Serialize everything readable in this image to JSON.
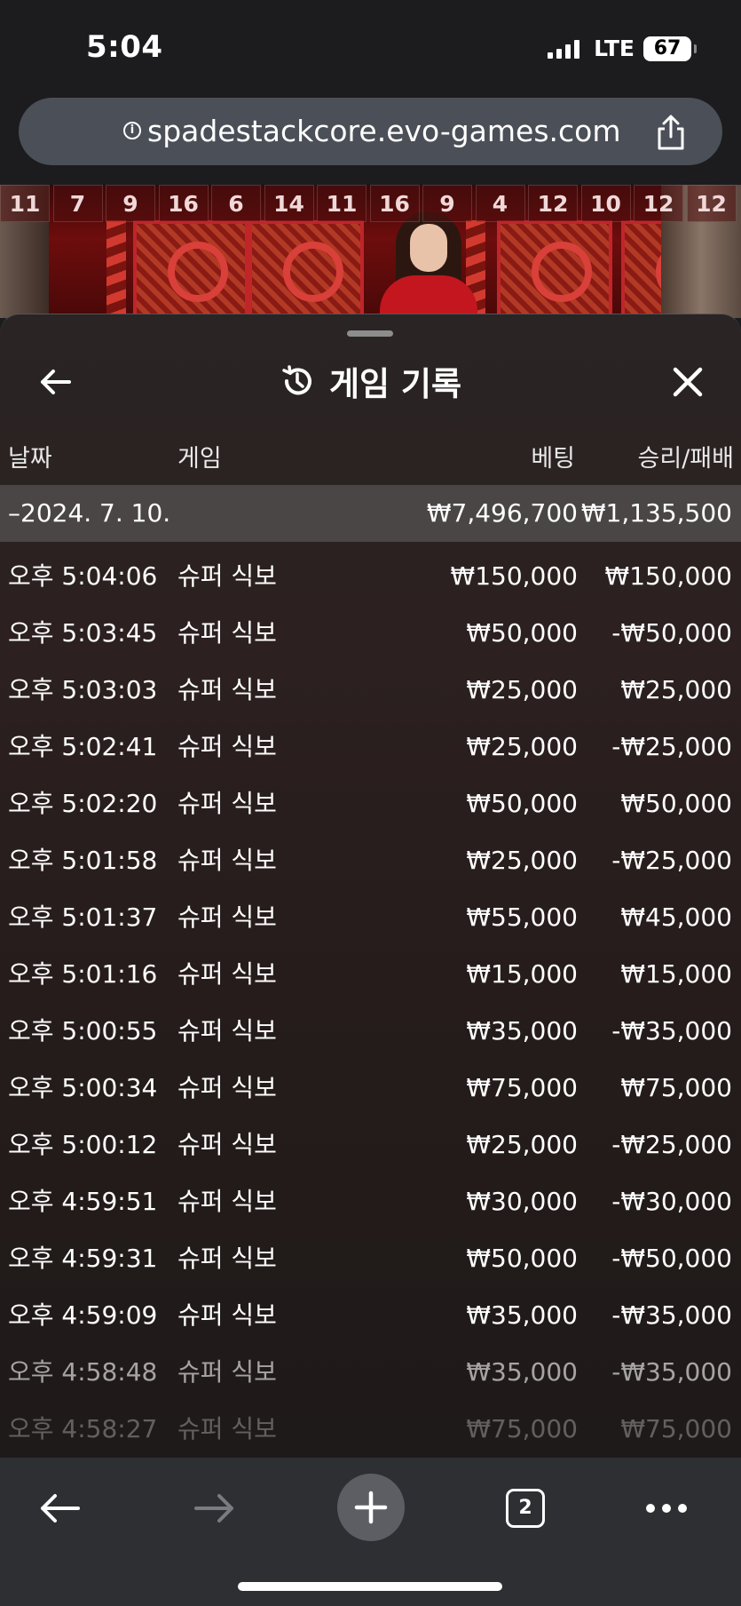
{
  "status_bar": {
    "time": "5:04",
    "network": "LTE",
    "battery": "67"
  },
  "browser": {
    "url": "spadestackcore.evo-games.com",
    "tab_count": "2"
  },
  "results_strip": [
    "11",
    "7",
    "9",
    "16",
    "6",
    "14",
    "11",
    "16",
    "9",
    "4",
    "12",
    "10",
    "12",
    "12"
  ],
  "history": {
    "title": "게임 기록",
    "columns": {
      "date": "날짜",
      "game": "게임",
      "bet": "베팅",
      "win_loss": "승리/패배"
    },
    "date_group": {
      "label": "–2024. 7. 10.",
      "total_bet": "₩7,496,700",
      "total_win_loss": "₩1,135,500"
    },
    "rows": [
      {
        "time": "오후 5:04:06",
        "game": "슈퍼 식보",
        "bet": "₩150,000",
        "result": "₩150,000"
      },
      {
        "time": "오후 5:03:45",
        "game": "슈퍼 식보",
        "bet": "₩50,000",
        "result": "-₩50,000"
      },
      {
        "time": "오후 5:03:03",
        "game": "슈퍼 식보",
        "bet": "₩25,000",
        "result": "₩25,000"
      },
      {
        "time": "오후 5:02:41",
        "game": "슈퍼 식보",
        "bet": "₩25,000",
        "result": "-₩25,000"
      },
      {
        "time": "오후 5:02:20",
        "game": "슈퍼 식보",
        "bet": "₩50,000",
        "result": "₩50,000"
      },
      {
        "time": "오후 5:01:58",
        "game": "슈퍼 식보",
        "bet": "₩25,000",
        "result": "-₩25,000"
      },
      {
        "time": "오후 5:01:37",
        "game": "슈퍼 식보",
        "bet": "₩55,000",
        "result": "₩45,000"
      },
      {
        "time": "오후 5:01:16",
        "game": "슈퍼 식보",
        "bet": "₩15,000",
        "result": "₩15,000"
      },
      {
        "time": "오후 5:00:55",
        "game": "슈퍼 식보",
        "bet": "₩35,000",
        "result": "-₩35,000"
      },
      {
        "time": "오후 5:00:34",
        "game": "슈퍼 식보",
        "bet": "₩75,000",
        "result": "₩75,000"
      },
      {
        "time": "오후 5:00:12",
        "game": "슈퍼 식보",
        "bet": "₩25,000",
        "result": "-₩25,000"
      },
      {
        "time": "오후 4:59:51",
        "game": "슈퍼 식보",
        "bet": "₩30,000",
        "result": "-₩30,000"
      },
      {
        "time": "오후 4:59:31",
        "game": "슈퍼 식보",
        "bet": "₩50,000",
        "result": "-₩50,000"
      },
      {
        "time": "오후 4:59:09",
        "game": "슈퍼 식보",
        "bet": "₩35,000",
        "result": "-₩35,000"
      },
      {
        "time": "오후 4:58:48",
        "game": "슈퍼 식보",
        "bet": "₩35,000",
        "result": "-₩35,000"
      },
      {
        "time": "오후 4:58:27",
        "game": "슈퍼 식보",
        "bet": "₩75,000",
        "result": "₩75,000"
      }
    ]
  },
  "icons": {
    "back": "arrow-left-icon",
    "close": "close-icon",
    "history": "history-clock-icon",
    "share": "share-icon",
    "lock": "info-icon",
    "toolbar": [
      "back-arrow-icon",
      "forward-arrow-icon",
      "plus-icon",
      "tabs-icon",
      "more-icon"
    ]
  },
  "colors": {
    "panel_bg": "#2a2424",
    "date_row_bg": "#4a4646",
    "toolbar_bg": "#2e2f33",
    "url_bar_bg": "#4b4f57"
  }
}
